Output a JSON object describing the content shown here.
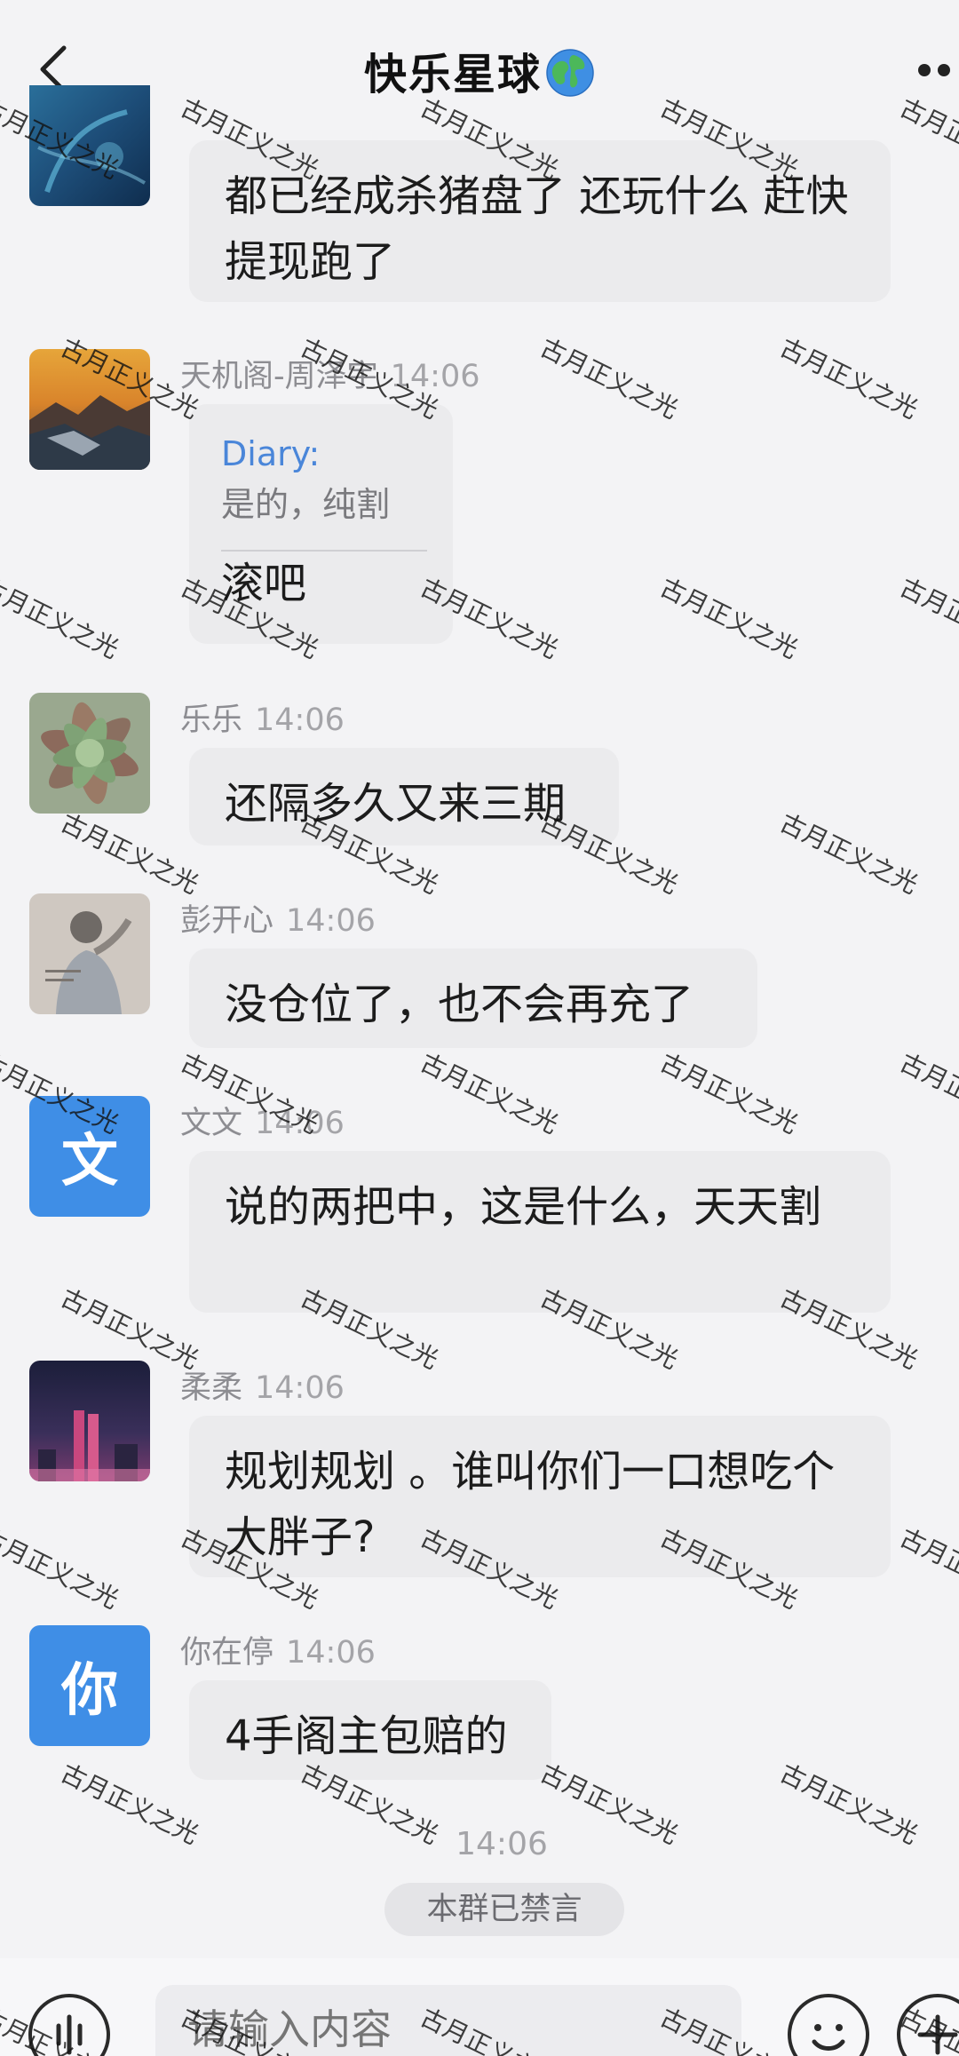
{
  "header": {
    "title": "快乐星球",
    "title_icon": "globe-icon"
  },
  "messages": [
    {
      "sender": "",
      "time": "",
      "text": "都已经成杀猪盘了 还玩什么 赶快提现跑了",
      "avatar": "photo-underwater"
    },
    {
      "sender": "天机阁-周泽宇",
      "time": "14:06",
      "quote_label": "Diary:",
      "quote_text": "是的，纯割",
      "text": "滚吧",
      "avatar": "photo-sunset-mountain"
    },
    {
      "sender": "乐乐",
      "time": "14:06",
      "text": "还隔多久又来三期",
      "avatar": "photo-succulent"
    },
    {
      "sender": "彭开心",
      "time": "14:06",
      "text": "没仓位了，也不会再充了",
      "avatar": "photo-person"
    },
    {
      "sender": "文文",
      "time": "14:06",
      "text": "说的两把中，这是什么，天天割",
      "avatar_letter": "文"
    },
    {
      "sender": "柔柔",
      "time": "14:06",
      "text": "规划规划 。谁叫你们一口想吃个大胖子?",
      "avatar": "photo-city-night"
    },
    {
      "sender": "你在停",
      "time": "14:06",
      "text": "4手阁主包赔的",
      "avatar_letter": "你"
    }
  ],
  "footer": {
    "time": "14:06",
    "muted_notice": "本群已禁言"
  },
  "input": {
    "placeholder": "请输入内容"
  },
  "watermark": "古月正义之光",
  "colors": {
    "background": "#f3f3f5",
    "bubble": "#ebebed",
    "letter_avatar": "#3f8ee6",
    "quote_label": "#4a86d9"
  }
}
